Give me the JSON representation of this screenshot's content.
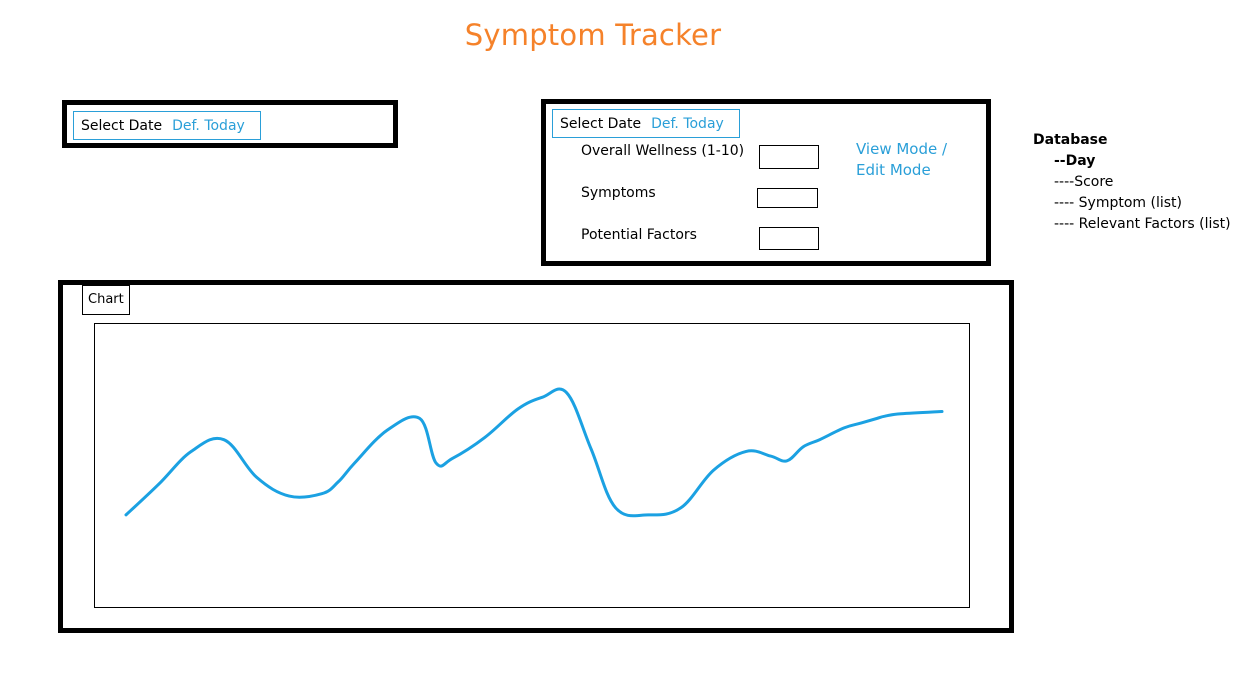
{
  "header": {
    "title": "Symptom Tracker"
  },
  "left_panel": {
    "select_date_label": "Select Date",
    "select_date_value": "Def. Today"
  },
  "entry_panel": {
    "select_date_label": "Select Date",
    "select_date_value": "Def. Today",
    "fields": [
      {
        "label": "Overall Wellness (1-10)",
        "value": ""
      },
      {
        "label": "Symptoms",
        "value": ""
      },
      {
        "label": "Potential Factors",
        "value": ""
      }
    ],
    "mode_line1": "View Mode /",
    "mode_line2": "Edit Mode"
  },
  "database_notes": {
    "heading": "Database",
    "lines": [
      "--Day",
      "----Score",
      "---- Symptom (list)",
      "---- Relevant Factors (list)"
    ]
  },
  "chart_panel": {
    "tab_label": "Chart"
  },
  "chart_data": {
    "type": "line",
    "title": "",
    "xlabel": "",
    "ylabel": "",
    "color": "#1BA1E2",
    "series": [
      {
        "name": "",
        "x": [
          0,
          4,
          8,
          12,
          16,
          20,
          24,
          26,
          28,
          32,
          36,
          38,
          40,
          44,
          48,
          51,
          54,
          57,
          60,
          64,
          68,
          72,
          76,
          79,
          81,
          83,
          85,
          88,
          90,
          92,
          93,
          95,
          100
        ],
        "values": [
          2.9,
          4.2,
          5.6,
          6.1,
          4.5,
          3.7,
          3.8,
          4.3,
          5.1,
          6.5,
          7.0,
          5.1,
          5.3,
          6.2,
          7.4,
          7.9,
          8.1,
          5.7,
          3.2,
          2.9,
          3.2,
          4.8,
          5.6,
          5.4,
          5.2,
          5.8,
          6.1,
          6.6,
          6.8,
          7.0,
          7.1,
          7.2,
          7.3
        ]
      }
    ],
    "ylim": [
      0,
      10
    ],
    "xlim": [
      0,
      100
    ],
    "grid": false,
    "legend": "none"
  },
  "colors": {
    "title": "#F5822A",
    "accent": "#2A9FD8",
    "line": "#1BA1E2"
  }
}
